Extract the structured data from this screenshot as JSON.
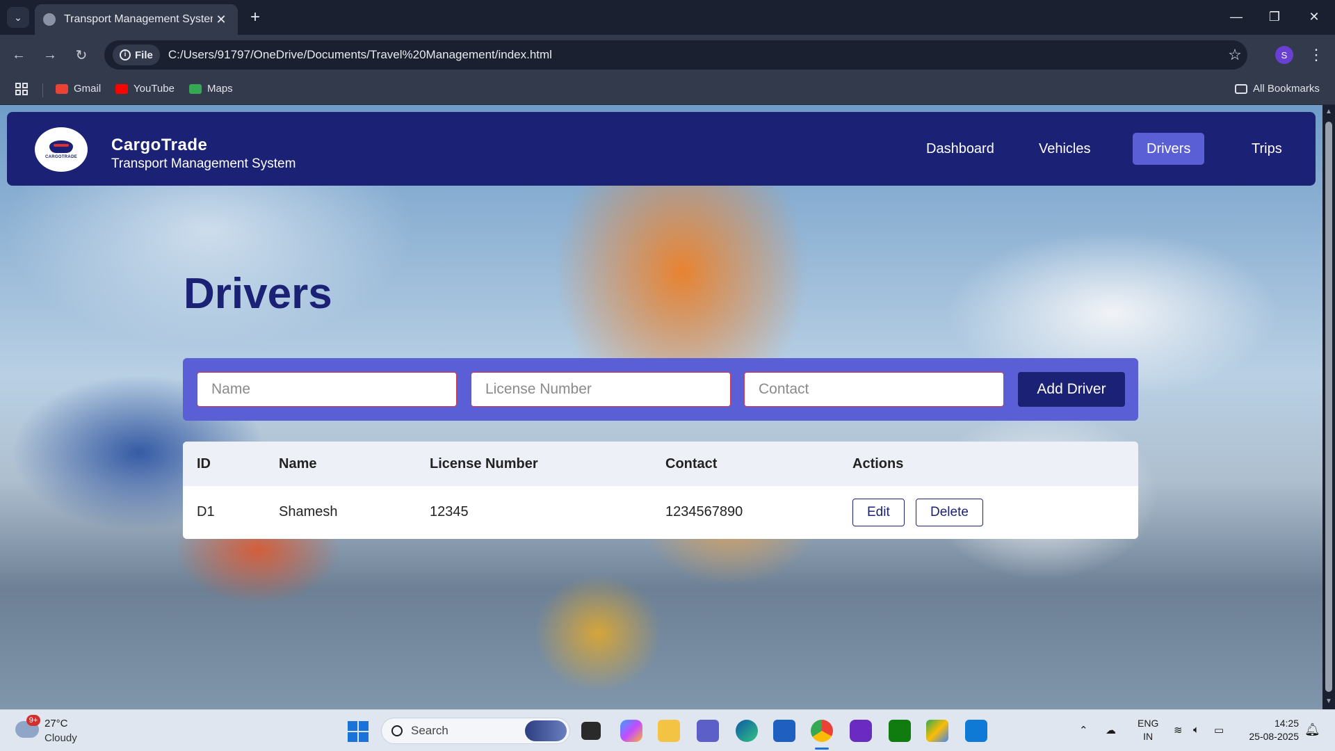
{
  "browser": {
    "tab_title": "Transport Management System",
    "url_chip": "File",
    "url": "C:/Users/91797/OneDrive/Documents/Travel%20Management/index.html",
    "profile_initial": "S",
    "bookmarks": [
      "Gmail",
      "YouTube",
      "Maps"
    ],
    "all_bookmarks": "All Bookmarks"
  },
  "app": {
    "brand_name": "CargoTrade",
    "brand_subtitle": "Transport Management System",
    "logo_text": "CARGOTRADE",
    "nav": [
      "Dashboard",
      "Vehicles",
      "Drivers",
      "Trips"
    ],
    "active_nav": "Drivers",
    "colors": {
      "primary": "#1b2275",
      "accent": "#5b5fd6"
    }
  },
  "page": {
    "title": "Drivers",
    "form": {
      "name_placeholder": "Name",
      "license_placeholder": "License Number",
      "contact_placeholder": "Contact",
      "submit_label": "Add Driver"
    },
    "table": {
      "headers": [
        "ID",
        "Name",
        "License Number",
        "Contact",
        "Actions"
      ],
      "rows": [
        {
          "id": "D1",
          "name": "Shamesh",
          "license": "12345",
          "contact": "1234567890"
        }
      ],
      "edit_label": "Edit",
      "delete_label": "Delete"
    }
  },
  "taskbar": {
    "weather_badge": "9+",
    "temperature": "27°C",
    "condition": "Cloudy",
    "search_label": "Search",
    "lang_top": "ENG",
    "lang_bottom": "IN",
    "time": "14:25",
    "date": "25-08-2025"
  }
}
